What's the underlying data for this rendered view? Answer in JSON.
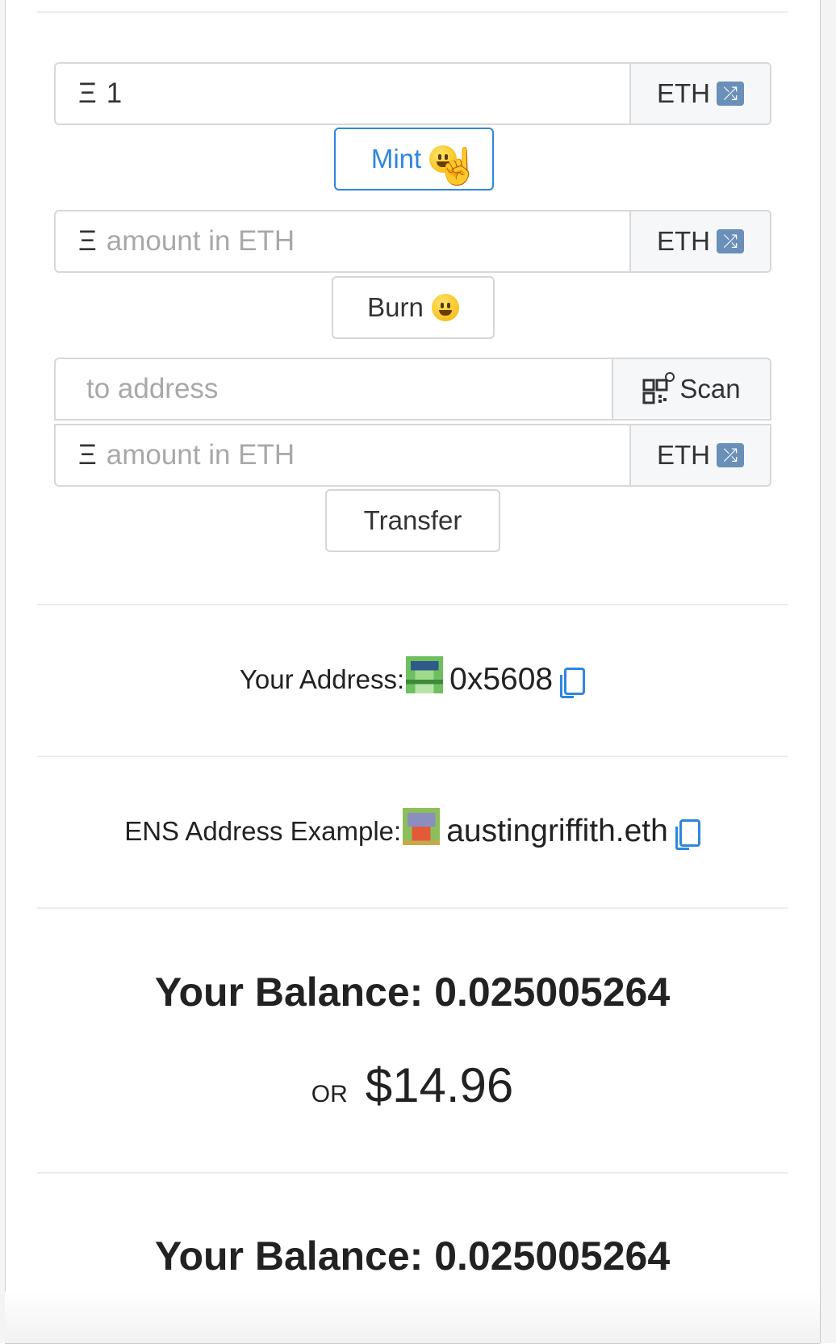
{
  "eth_symbol": "Ξ",
  "mint": {
    "amount_value": "1",
    "currency": "ETH",
    "button_label": "Mint"
  },
  "burn": {
    "amount_placeholder": "amount in ETH",
    "currency": "ETH",
    "button_label": "Burn"
  },
  "transfer": {
    "address_placeholder": "to address",
    "scan_label": "Scan",
    "amount_placeholder": "amount in ETH",
    "currency": "ETH",
    "button_label": "Transfer"
  },
  "your_address": {
    "label": "Your Address:",
    "value": "0x5608"
  },
  "ens_example": {
    "label": "ENS Address Example:",
    "value": "austingriffith.eth"
  },
  "balance_1": {
    "text": "Your Balance: 0.025005264",
    "or_label": "OR",
    "usd": "$14.96"
  },
  "balance_2": {
    "text": "Your Balance: 0.025005264"
  },
  "colors": {
    "primary": "#2e86de",
    "border": "#d8d8d8",
    "addon_bg": "#f6f7f8"
  }
}
